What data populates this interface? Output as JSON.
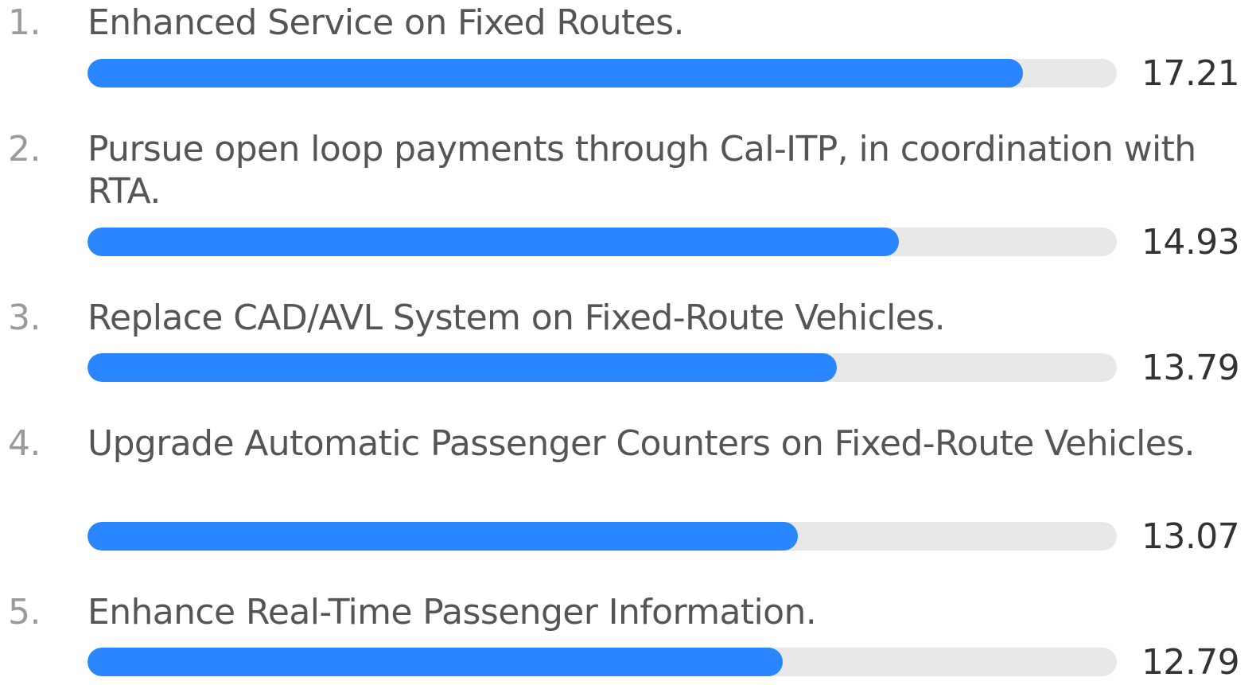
{
  "chart_data": {
    "type": "bar",
    "orientation": "horizontal",
    "items": [
      {
        "rank": "1.",
        "label": "Enhanced Service on Fixed Routes.",
        "value": 17.21,
        "display": "17.21"
      },
      {
        "rank": "2.",
        "label": "Pursue open loop payments through Cal-ITP, in coordination with RTA.",
        "value": 14.93,
        "display": "14.93"
      },
      {
        "rank": "3.",
        "label": "Replace CAD/AVL System on Fixed-Route Vehicles.",
        "value": 13.79,
        "display": "13.79"
      },
      {
        "rank": "4.",
        "label": "Upgrade Automatic Passenger Counters on Fixed-Route Vehicles.",
        "value": 13.07,
        "display": "13.07"
      },
      {
        "rank": "5.",
        "label": "Enhance Real-Time Passenger Information.",
        "value": 12.79,
        "display": "12.79"
      }
    ],
    "xmax": 18.94,
    "colors": {
      "fill": "#2a86ff",
      "track": "#e8e8e8"
    }
  }
}
